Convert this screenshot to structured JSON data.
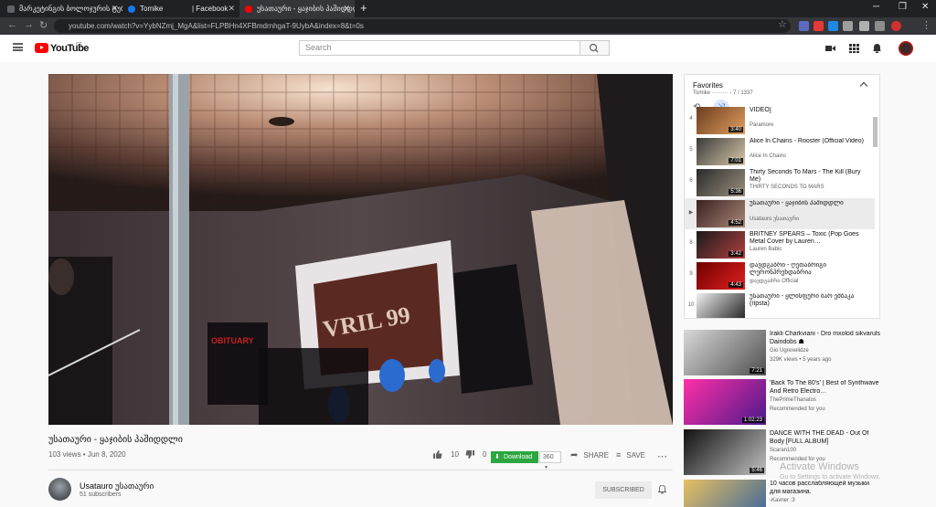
{
  "browser": {
    "tabs": [
      {
        "label": "მარკეტინგის ბოლოჯურის ტურ…",
        "favicon_color": "#5f6368"
      },
      {
        "label": "Tomike",
        "favicon_color": "#1877f2"
      },
      {
        "label": "| Facebook",
        "favicon_color": "#1877f2"
      },
      {
        "label": "უსათაური - ყაჯიბის პაშიდდლი",
        "favicon_color": "#ff0000"
      }
    ],
    "new_tab_label": "+",
    "url": "youtube.com/watch?v=YybNZmj_MgA&list=FLPBHn4XFBmdrnhgaT-9UybA&index=8&t=0s"
  },
  "masthead": {
    "logo_text": "YouTube",
    "region": "GE",
    "search_placeholder": "Search"
  },
  "video": {
    "title": "უსათაური - ყაჯიბის პაშიდდლი",
    "meta": "103 views • Jun 8, 2020",
    "likes": "10",
    "dislikes": "0",
    "download_label": "Download",
    "quality": "360",
    "share_label": "SHARE",
    "save_label": "SAVE",
    "more_label": "⋯",
    "poster_text": "VRIL 99",
    "amp_text": "OBITUARY"
  },
  "channel": {
    "name": "Usatauro უსათაური",
    "subscribers": "51 subscribers",
    "subscribed_label": "SUBSCRIBED"
  },
  "playlist": {
    "title": "Favorites",
    "subtitle": "Tomike ········· - 7 / 1337",
    "items": [
      {
        "index": "4",
        "title": "VIDEO]",
        "channel": "Paramore",
        "duration": "3:40",
        "colors": [
          "#6b3c1e",
          "#e0a060"
        ]
      },
      {
        "index": "5",
        "title": "Alice In Chains - Rooster (Official Video)",
        "channel": "Alice In Chains",
        "duration": "7:01",
        "colors": [
          "#3a3a3a",
          "#d8c8a8"
        ]
      },
      {
        "index": "6",
        "title": "Thirty Seconds To Mars - The Kill (Bury Me)",
        "channel": "THIRTY SECONDS TO MARS",
        "duration": "5:36",
        "colors": [
          "#2a2a2a",
          "#9a9080"
        ]
      },
      {
        "index": "▶",
        "title": "უსათაური - ყაჯიბის პაშიდდლი",
        "channel": "Usatauro უსათაური",
        "duration": "4:52",
        "colors": [
          "#3a2020",
          "#a88878"
        ]
      },
      {
        "index": "8",
        "title": "BRITNEY SPEARS – Toxic (Pop Goes Metal Cover by Lauren…",
        "channel": "Lauren Babic",
        "duration": "3:42",
        "colors": [
          "#1a1a1a",
          "#b04040"
        ]
      },
      {
        "index": "9",
        "title": "დავდგაბრი - ღეთაბრიგი ლერონპრეხდაბრია",
        "channel": "დავდგაბრი Official",
        "duration": "4:43",
        "colors": [
          "#700000",
          "#e02020"
        ]
      },
      {
        "index": "10",
        "title": "უსათაური - ყლისფერი ბარ ემბაკა (ripsta)",
        "channel": "",
        "duration": "",
        "colors": [
          "#f0f0f0",
          "#222222"
        ]
      }
    ]
  },
  "recommendations": [
    {
      "title": "Irakli Charkviani - Dro mxolod sikvaruls Daindobs ☗",
      "channel": "Gio Ugrexelidze",
      "meta": "329K views • 5 years ago",
      "duration": "7:21",
      "colors": [
        "#d8d8d8",
        "#505050"
      ]
    },
    {
      "title": "'Back To The 80's' | Best of Synthwave And Retro Electro…",
      "channel": "ThePrimeThanatos",
      "meta": "Recommended for you",
      "duration": "1:02:23",
      "colors": [
        "#ff2fa8",
        "#4a1a8a"
      ]
    },
    {
      "title": "DANCE WITH THE DEAD - Out Of Body [FULL ALBUM]",
      "channel": "Scaran100",
      "meta": "Recommended for you",
      "duration": "5:46",
      "colors": [
        "#101010",
        "#c0c0c0"
      ]
    },
    {
      "title": "10 часов расслабляющей музыки для магазина.",
      "channel": "-Kavner :3",
      "meta": "",
      "duration": "",
      "colors": [
        "#e8c060",
        "#3060a0"
      ]
    }
  ],
  "os_watermark": {
    "title": "Activate Windows",
    "subtitle": "Go to Settings to activate Windows."
  },
  "colors": {
    "brand_red": "#ff0000",
    "download_green": "#2ba640",
    "accent_blue": "#065fd4"
  }
}
